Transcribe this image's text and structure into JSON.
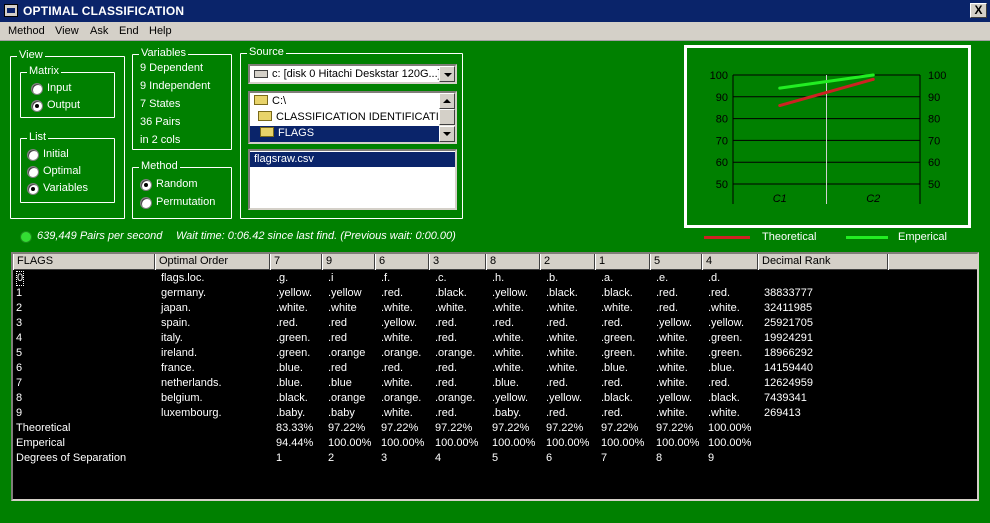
{
  "window": {
    "title": "OPTIMAL CLASSIFICATION",
    "close_label": "X"
  },
  "menu": [
    "Method",
    "View",
    "Ask",
    "End",
    "Help"
  ],
  "view_group": {
    "label": "View",
    "matrix": {
      "label": "Matrix",
      "options": [
        "Input",
        "Output"
      ],
      "selected": 1
    },
    "list": {
      "label": "List",
      "options": [
        "Initial",
        "Optimal",
        "Variables"
      ],
      "selected": 2
    }
  },
  "variables_group": {
    "label": "Variables",
    "lines": [
      "9 Dependent",
      "9 Independent",
      "7 States",
      "36 Pairs",
      "in 2 cols"
    ]
  },
  "method_group": {
    "label": "Method",
    "options": [
      "Random",
      "Permutation"
    ],
    "selected": 0
  },
  "source_group": {
    "label": "Source",
    "drive": "c: [disk 0 Hitachi Deskstar 120G...]",
    "folders": [
      "C:\\",
      "CLASSIFICATION IDENTIFICATION",
      "FLAGS"
    ],
    "selected_folder": 2,
    "files": [
      "flagsraw.csv"
    ],
    "selected_file": 0
  },
  "status": {
    "rate": "639,449 Pairs per second",
    "wait": "Wait time: 0:06.42 since last find. (Previous wait: 0:00.00)"
  },
  "colors": {
    "background": "#008000",
    "theoretical": "#cc2222",
    "emperical": "#22ee22",
    "title_bar": "#0a246a"
  },
  "chart_data": {
    "type": "line",
    "categories": [
      "C1",
      "C2"
    ],
    "series": [
      {
        "name": "Theoretical",
        "values": [
          86,
          98
        ]
      },
      {
        "name": "Emperical",
        "values": [
          94,
          100
        ]
      }
    ],
    "ylim": [
      50,
      100
    ],
    "yticks": [
      100,
      90,
      80,
      70,
      60,
      50
    ],
    "grid": true,
    "legend": "bottom"
  },
  "grid": {
    "headers": [
      "FLAGS",
      "Optimal Order",
      "7",
      "9",
      "6",
      "3",
      "8",
      "2",
      "1",
      "5",
      "4",
      "Decimal Rank"
    ],
    "rows": [
      [
        "0",
        "flags.loc.",
        ".g.",
        ".i",
        ".f.",
        ".c.",
        ".h.",
        ".b.",
        ".a.",
        ".e.",
        ".d.",
        ""
      ],
      [
        "1",
        "germany.",
        ".yellow.",
        ".yellow",
        ".red.",
        ".black.",
        ".yellow.",
        ".black.",
        ".black.",
        ".red.",
        ".red.",
        "38833777"
      ],
      [
        "2",
        "japan.",
        ".white.",
        ".white",
        ".white.",
        ".white.",
        ".white.",
        ".white.",
        ".white.",
        ".red.",
        ".white.",
        "32411985"
      ],
      [
        "3",
        "spain.",
        ".red.",
        ".red",
        ".yellow.",
        ".red.",
        ".red.",
        ".red.",
        ".red.",
        ".yellow.",
        ".yellow.",
        "25921705"
      ],
      [
        "4",
        "italy.",
        ".green.",
        ".red",
        ".white.",
        ".red.",
        ".white.",
        ".white.",
        ".green.",
        ".white.",
        ".green.",
        "19924291"
      ],
      [
        "5",
        "ireland.",
        ".green.",
        ".orange",
        ".orange.",
        ".orange.",
        ".white.",
        ".white.",
        ".green.",
        ".white.",
        ".green.",
        "18966292"
      ],
      [
        "6",
        "france.",
        ".blue.",
        ".red",
        ".red.",
        ".red.",
        ".white.",
        ".white.",
        ".blue.",
        ".white.",
        ".blue.",
        "14159440"
      ],
      [
        "7",
        "netherlands.",
        ".blue.",
        ".blue",
        ".white.",
        ".red.",
        ".blue.",
        ".red.",
        ".red.",
        ".white.",
        ".red.",
        "12624959"
      ],
      [
        "8",
        "belgium.",
        ".black.",
        ".orange",
        ".orange.",
        ".orange.",
        ".yellow.",
        ".yellow.",
        ".black.",
        ".yellow.",
        ".black.",
        "7439341"
      ],
      [
        "9",
        "luxembourg.",
        ".baby.",
        ".baby",
        ".white.",
        ".red.",
        ".baby.",
        ".red.",
        ".red.",
        ".white.",
        ".white.",
        "269413"
      ],
      [
        "Theoretical",
        "",
        "83.33%",
        "97.22%",
        "97.22%",
        "97.22%",
        "97.22%",
        "97.22%",
        "97.22%",
        "97.22%",
        "100.00%",
        ""
      ],
      [
        "Emperical",
        "",
        "94.44%",
        "100.00%",
        "100.00%",
        "100.00%",
        "100.00%",
        "100.00%",
        "100.00%",
        "100.00%",
        "100.00%",
        ""
      ],
      [
        "Degrees of Separation",
        "",
        "1",
        "2",
        "3",
        "4",
        "5",
        "6",
        "7",
        "8",
        "9",
        ""
      ]
    ]
  }
}
